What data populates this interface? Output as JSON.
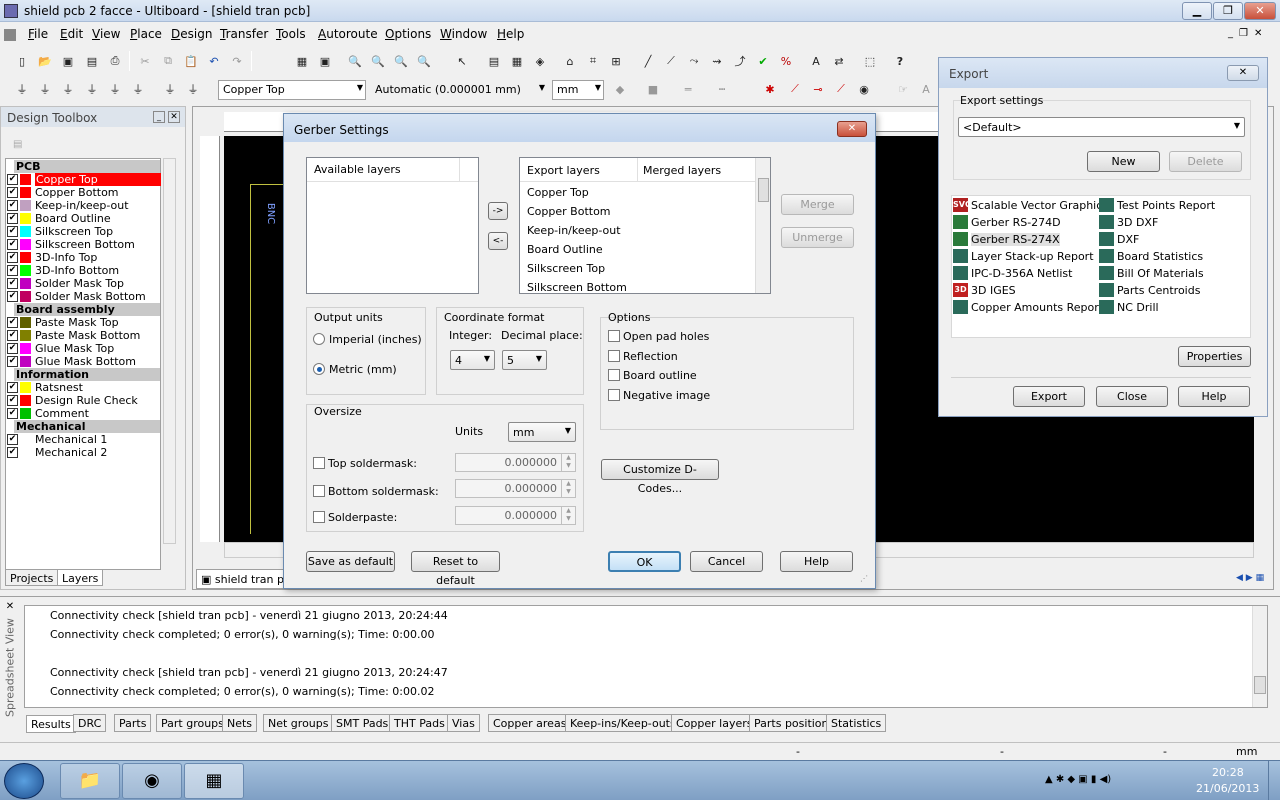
{
  "window": {
    "title": "shield pcb 2 facce - Ultiboard - [shield tran pcb]"
  },
  "menu": [
    {
      "label": "File",
      "u": "F",
      "rest": "ile"
    },
    {
      "label": "Edit",
      "u": "E",
      "rest": "dit"
    },
    {
      "label": "View",
      "u": "V",
      "rest": "iew"
    },
    {
      "label": "Place",
      "u": "P",
      "rest": "lace"
    },
    {
      "label": "Design",
      "u": "D",
      "rest": "esign"
    },
    {
      "label": "Transfer",
      "u": "T",
      "rest": "ransfer"
    },
    {
      "label": "Tools",
      "u": "T",
      "rest": "ools"
    },
    {
      "label": "Autoroute",
      "u": "A",
      "rest": "utoroute"
    },
    {
      "label": "Options",
      "u": "O",
      "rest": "ptions"
    },
    {
      "label": "Window",
      "u": "W",
      "rest": "indow"
    },
    {
      "label": "Help",
      "u": "H",
      "rest": "elp"
    }
  ],
  "toolbar2": {
    "layer": "Copper Top",
    "grid": "Automatic (0.000001 mm)",
    "units": "mm"
  },
  "toolbox": {
    "title": "Design Toolbox",
    "tabs": [
      "Projects",
      "Layers"
    ],
    "groups": [
      {
        "name": "PCB",
        "layers": [
          {
            "name": "Copper Top",
            "color": "#ff0000",
            "selected": true
          },
          {
            "name": "Copper Bottom",
            "color": "#ff0000"
          },
          {
            "name": "Keep-in/keep-out",
            "color": "#c0a0c0"
          },
          {
            "name": "Board Outline",
            "color": "#ffff00"
          },
          {
            "name": "Silkscreen Top",
            "color": "#00ffff"
          },
          {
            "name": "Silkscreen Bottom",
            "color": "#ff00ff"
          },
          {
            "name": "3D-Info Top",
            "color": "#ff0000"
          },
          {
            "name": "3D-Info Bottom",
            "color": "#00ff00"
          },
          {
            "name": "Solder Mask Top",
            "color": "#c000c0"
          },
          {
            "name": "Solder Mask Bottom",
            "color": "#c00060"
          }
        ]
      },
      {
        "name": "Board assembly",
        "layers": [
          {
            "name": "Paste Mask Top",
            "color": "#606000"
          },
          {
            "name": "Paste Mask Bottom",
            "color": "#808000"
          },
          {
            "name": "Glue Mask Top",
            "color": "#ff00ff"
          },
          {
            "name": "Glue Mask Bottom",
            "color": "#c000c0"
          }
        ]
      },
      {
        "name": "Information",
        "layers": [
          {
            "name": "Ratsnest",
            "color": "#ffff00"
          },
          {
            "name": "Design Rule Check",
            "color": "#ff0000"
          },
          {
            "name": "Comment",
            "color": "#00c000"
          }
        ]
      },
      {
        "name": "Mechanical",
        "layers": [
          {
            "name": "Mechanical 1",
            "color": "#ffffff"
          },
          {
            "name": "Mechanical 2",
            "color": "#ffffff"
          }
        ]
      }
    ]
  },
  "doc_tab": "shield tran pcb",
  "canvas_label": "BNC",
  "gerber": {
    "title": "Gerber Settings",
    "available_header": "Available layers",
    "export_header": "Export layers",
    "merged_header": "Merged layers",
    "export_layers": [
      "Copper Top",
      "Copper Bottom",
      "Keep-in/keep-out",
      "Board Outline",
      "Silkscreen Top",
      "Silkscreen Bottom"
    ],
    "add_arrow": "->",
    "remove_arrow": "<-",
    "merge": "Merge",
    "unmerge": "Unmerge",
    "output_units": {
      "title": "Output units",
      "imperial": "Imperial (inches)",
      "metric": "Metric (mm)",
      "selected": "metric"
    },
    "coord": {
      "title": "Coordinate format",
      "integer_label": "Integer:",
      "decimal_label": "Decimal place:",
      "integer": "4",
      "decimal": "5"
    },
    "options": {
      "title": "Options",
      "items": [
        "Open pad holes",
        "Reflection",
        "Board outline",
        "Negative image"
      ]
    },
    "oversize": {
      "title": "Oversize",
      "units_label": "Units",
      "units": "mm",
      "rows": [
        {
          "label": "Top soldermask:",
          "value": "0.000000"
        },
        {
          "label": "Bottom soldermask:",
          "value": "0.000000"
        },
        {
          "label": "Solderpaste:",
          "value": "0.000000"
        }
      ]
    },
    "dcodes": "Customize D-Codes...",
    "save_default": "Save as default",
    "reset_default": "Reset to default",
    "ok": "OK",
    "cancel": "Cancel",
    "help": "Help"
  },
  "export": {
    "title": "Export",
    "settings_label": "Export settings",
    "settings_value": "<Default>",
    "new": "New",
    "delete": "Delete",
    "formats_left": [
      {
        "name": "Scalable Vector Graphics",
        "icon": "svg-icon"
      },
      {
        "name": "Gerber RS-274D",
        "icon": "gerber-icon"
      },
      {
        "name": "Gerber RS-274X",
        "icon": "gerber-icon",
        "selected": true
      },
      {
        "name": "Layer Stack-up Report",
        "icon": "report-icon"
      },
      {
        "name": "IPC-D-356A Netlist",
        "icon": "netlist-icon"
      },
      {
        "name": "3D IGES",
        "icon": "3d-icon"
      },
      {
        "name": "Copper Amounts Report",
        "icon": "report-icon"
      }
    ],
    "formats_right": [
      {
        "name": "Test Points Report",
        "icon": "report-icon"
      },
      {
        "name": "3D DXF",
        "icon": "dxf-icon"
      },
      {
        "name": "DXF",
        "icon": "dxf-icon"
      },
      {
        "name": "Board Statistics",
        "icon": "report-icon"
      },
      {
        "name": "Bill Of Materials",
        "icon": "report-icon"
      },
      {
        "name": "Parts Centroids",
        "icon": "report-icon"
      },
      {
        "name": "NC Drill",
        "icon": "drill-icon"
      }
    ],
    "properties": "Properties",
    "export_btn": "Export",
    "close": "Close",
    "help": "Help"
  },
  "spreadsheet": {
    "side_label": "Spreadsheet View",
    "lines": [
      "Connectivity check [shield tran pcb]  - venerdì 21 giugno 2013, 20:24:44",
      "Connectivity check completed;  0 error(s), 0 warning(s);  Time: 0:00.00",
      "Connectivity check [shield tran pcb]  - venerdì 21 giugno 2013, 20:24:47",
      "Connectivity check completed;  0 error(s), 0 warning(s);  Time: 0:00.02"
    ],
    "tabs": [
      "Results",
      "DRC",
      "Parts",
      "Part groups",
      "Nets",
      "Net groups",
      "SMT Pads",
      "THT Pads",
      "Vias",
      "Copper areas",
      "Keep-ins/Keep-outs",
      "Copper layers",
      "Parts position",
      "Statistics"
    ]
  },
  "status": {
    "dash1": "-",
    "dash2": "-",
    "dash3": "-",
    "units": "mm"
  },
  "taskbar": {
    "time": "20:28",
    "date": "21/06/2013"
  }
}
